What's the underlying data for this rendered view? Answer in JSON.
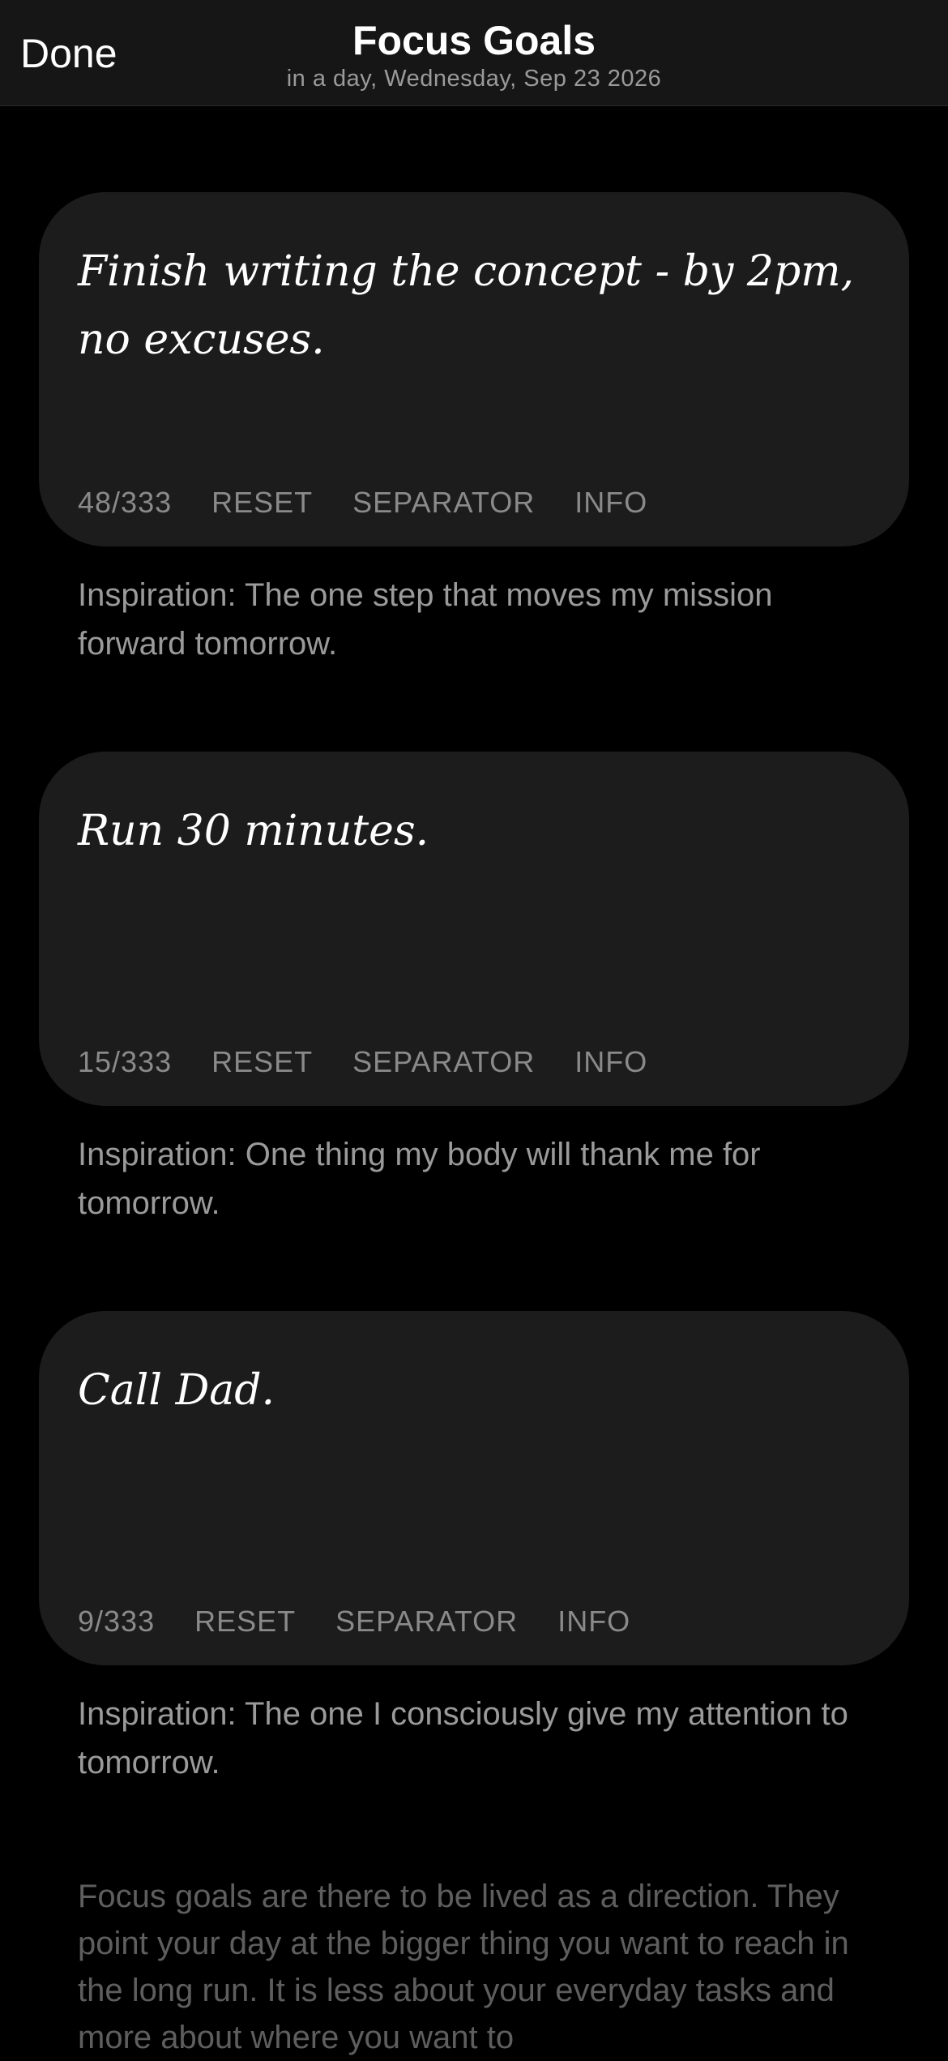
{
  "navbar": {
    "done_label": "Done",
    "title": "Focus Goals",
    "subtitle": "in a day, Wednesday, Sep 23 2026"
  },
  "goals": [
    {
      "text": "Finish writing the concept - by 2pm, no excuses.",
      "count": "48/333",
      "reset_label": "RESET",
      "separator_label": "SEPARATOR",
      "info_label": "INFO",
      "inspiration": "Inspiration: The one step that moves my mission forward tomorrow."
    },
    {
      "text": "Run 30 minutes.",
      "count": "15/333",
      "reset_label": "RESET",
      "separator_label": "SEPARATOR",
      "info_label": "INFO",
      "inspiration": "Inspiration: One thing my body will thank me for tomorrow."
    },
    {
      "text": "Call Dad.",
      "count": "9/333",
      "reset_label": "RESET",
      "separator_label": "SEPARATOR",
      "info_label": "INFO",
      "inspiration": "Inspiration: The one I consciously give my attention to tomorrow."
    }
  ],
  "footnote": "Focus goals are there to be lived as a direction. They point your day at the bigger thing you want to reach in the long run. It is less about your everyday tasks and more about where you want to"
}
